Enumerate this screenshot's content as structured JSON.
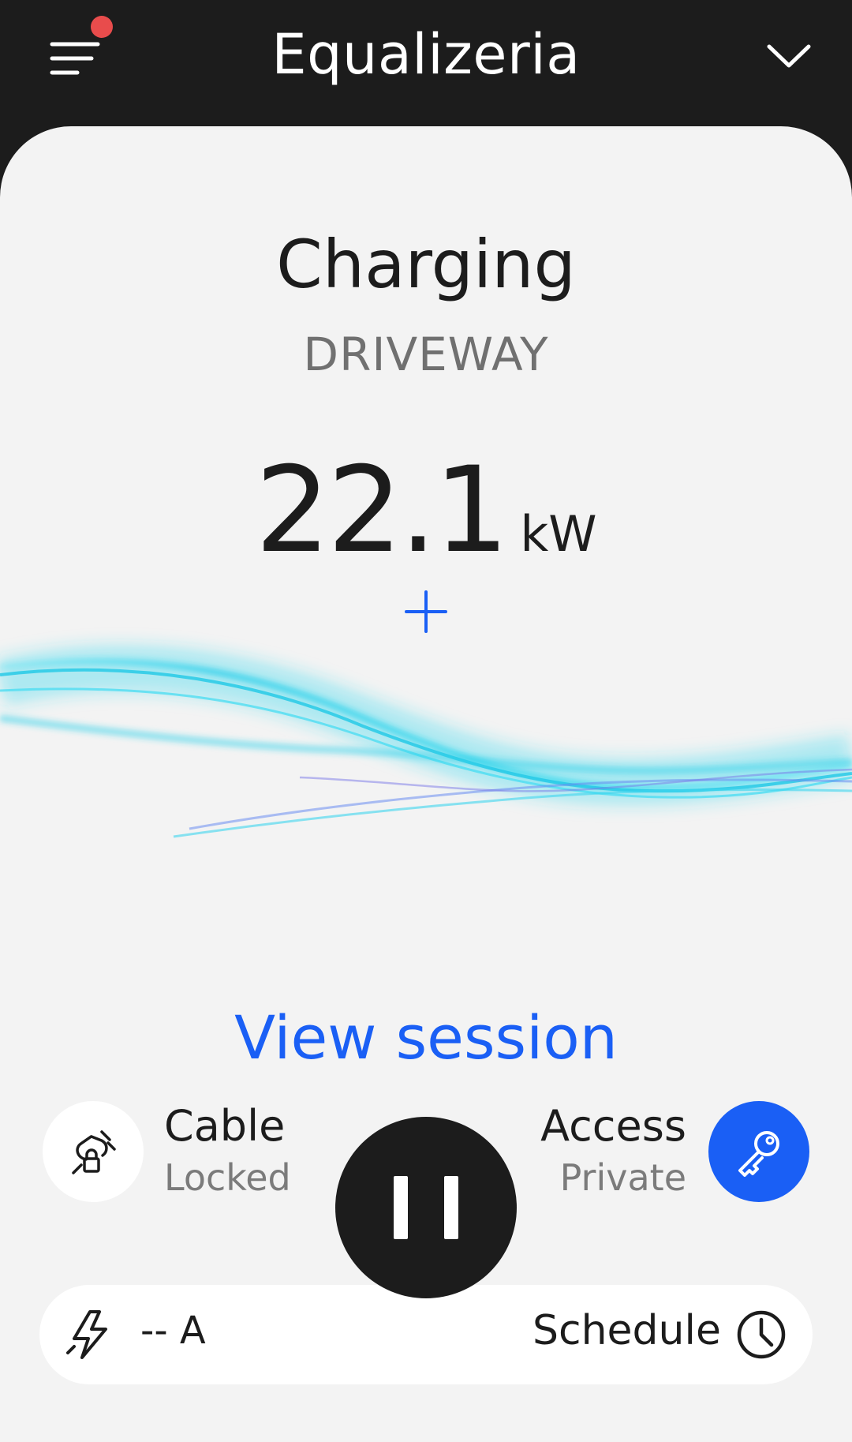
{
  "header": {
    "title": "Equalizeria",
    "menu_icon": "menu-icon",
    "chevron_icon": "chevron-down-icon",
    "notification_color": "#e84c4c"
  },
  "status": {
    "title": "Charging",
    "station": "DRIVEWAY",
    "power_value": "22.1",
    "power_unit": "kW"
  },
  "actions": {
    "view_session": "View session"
  },
  "cable": {
    "title": "Cable",
    "state": "Locked",
    "icon": "plug-lock-icon"
  },
  "access": {
    "title": "Access",
    "state": "Private",
    "icon": "key-icon"
  },
  "controls": {
    "current": "-- A",
    "schedule": "Schedule",
    "bolt_icon": "bolt-icon",
    "clock_icon": "clock-icon",
    "pause_icon": "pause-icon"
  },
  "colors": {
    "accent": "#1a5ff5",
    "dark": "#1c1c1c",
    "background": "#f3f3f3",
    "wave": "#28d6ef"
  }
}
